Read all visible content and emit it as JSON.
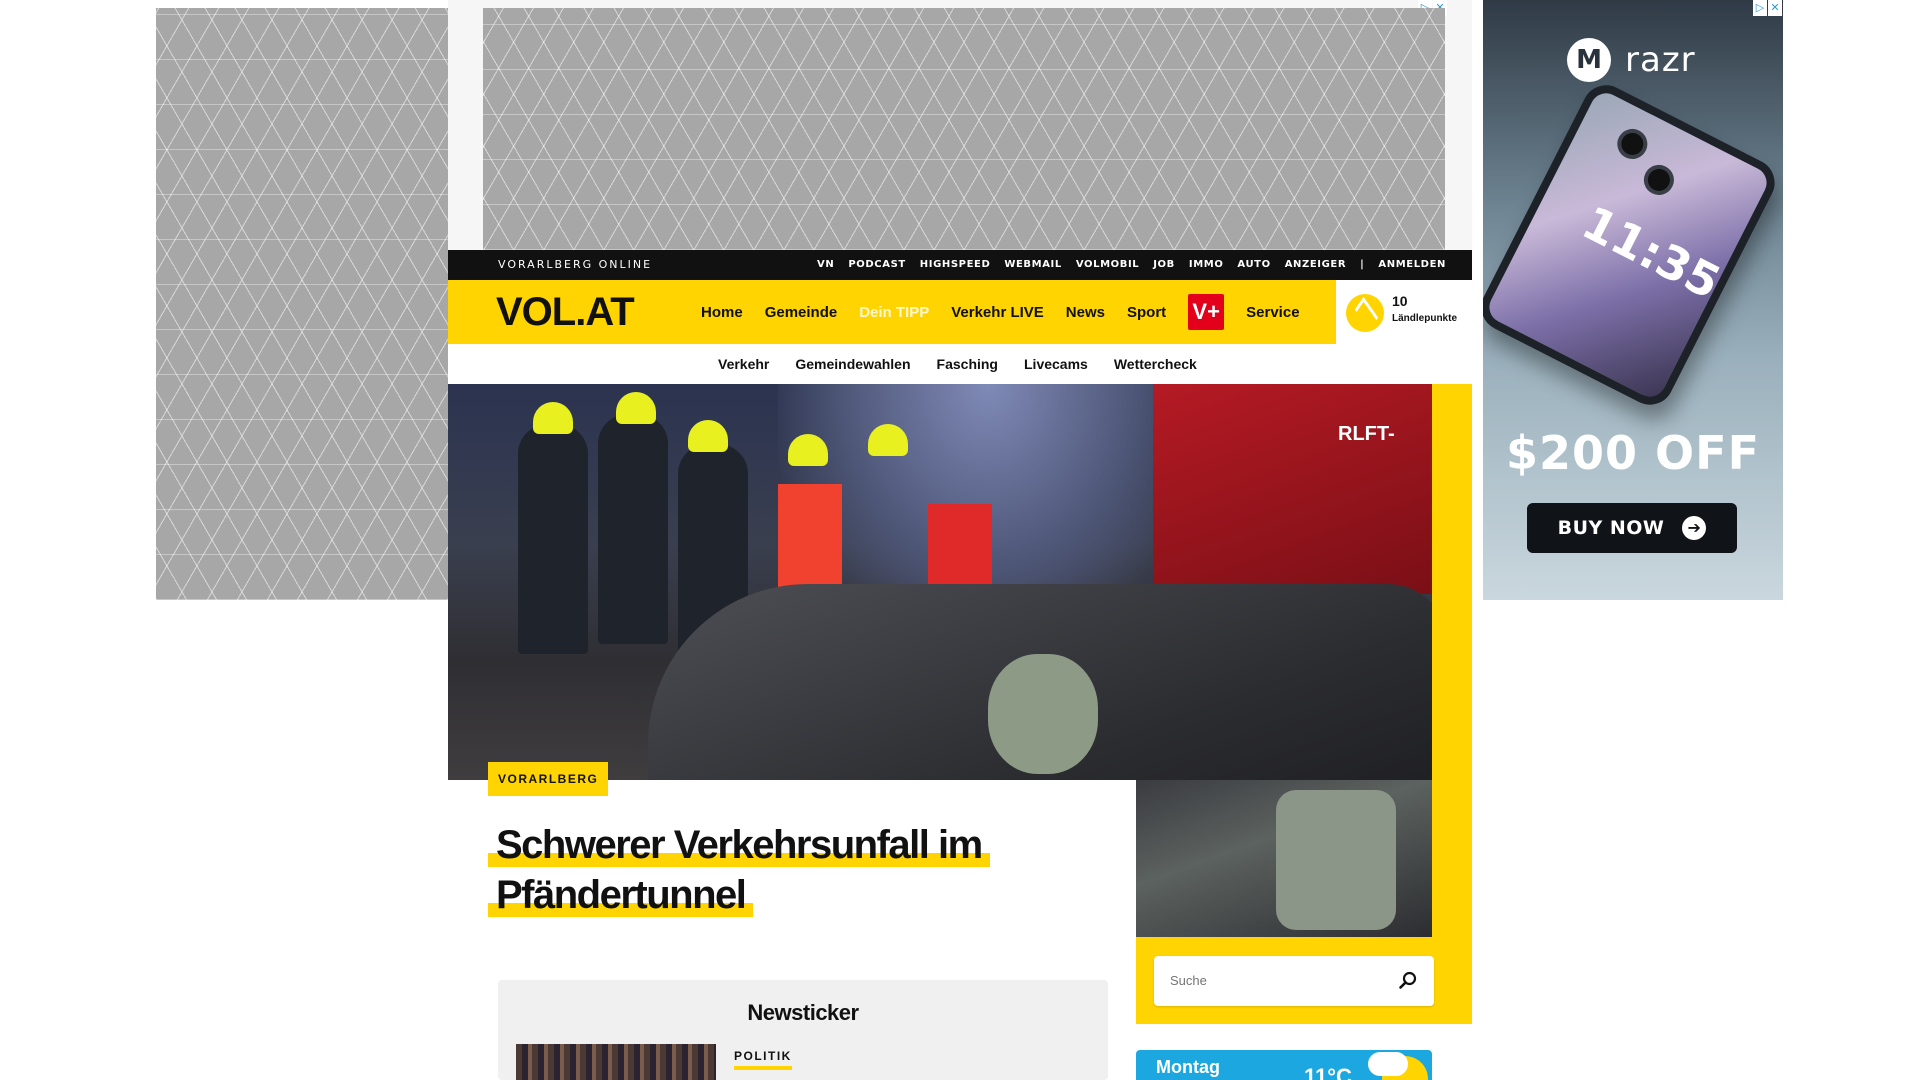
{
  "ads": {
    "choices_icon": "adchoices-icon",
    "choices_glyph": "▷",
    "close_glyph": "✕",
    "right": {
      "brand_mark": "M",
      "brand": "razr",
      "phone_time": "11:35",
      "offer": "$200 OFF",
      "cta": "BUY NOW",
      "cta_arrow": "➔"
    }
  },
  "topbar": {
    "brand": "VORARLBERG ONLINE",
    "links": [
      "VN",
      "PODCAST",
      "HIGHSPEED",
      "WEBMAIL",
      "VOLMOBIL",
      "JOB",
      "IMMO",
      "AUTO",
      "ANZEIGER",
      "|",
      "ANMELDEN"
    ]
  },
  "nav": {
    "logo": "VOL.AT",
    "items": [
      "Home",
      "Gemeinde",
      "Dein TIPP",
      "Verkehr LIVE",
      "News",
      "Sport"
    ],
    "vplus": "V+",
    "service": "Service",
    "points_value": "10",
    "points_label": "Ländlepunkte",
    "accent": "#ffd400"
  },
  "subnav": [
    "Verkehr",
    "Gemeindewahlen",
    "Fasching",
    "Livecams",
    "Wettercheck"
  ],
  "hero": {
    "truck_label": "RLFT-"
  },
  "article": {
    "category": "VORARLBERG",
    "headline": "Schwerer Verkehrsunfall im Pfändertunnel"
  },
  "search": {
    "placeholder": "Suche",
    "icon": "search-icon"
  },
  "weather": {
    "day": "Montag",
    "temp": "11°C"
  },
  "ticker": {
    "title": "Newsticker",
    "tag": "POLITIK"
  }
}
